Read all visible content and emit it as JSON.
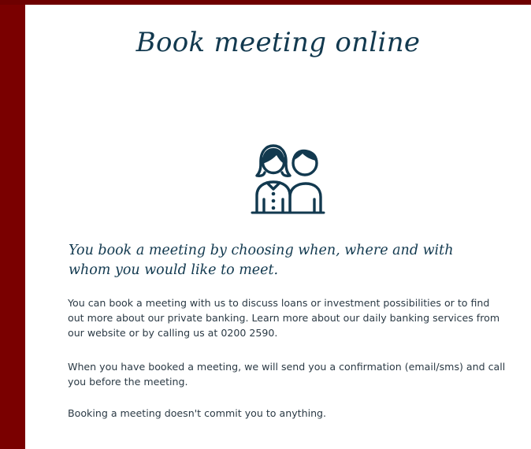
{
  "page": {
    "title": "Book meeting online"
  },
  "illustration": {
    "icon": "two-people-icon",
    "stroke_color": "#12394f"
  },
  "content": {
    "lead": "You book a meeting by choosing when, where and with whom you would like to meet.",
    "paragraphs": [
      "You can book a meeting with us to discuss loans or investment possibilities or to find out more about our private banking. Learn more about our daily banking services from our website or by calling us at 0200 2590.",
      "When you have booked a meeting, we will send you a confirmation (email/sms) and call you before the meeting.",
      "Booking a meeting doesn't commit you to anything."
    ]
  },
  "colors": {
    "brand_frame": "#7a0000",
    "text_primary": "#12394f",
    "background": "#ffffff"
  }
}
